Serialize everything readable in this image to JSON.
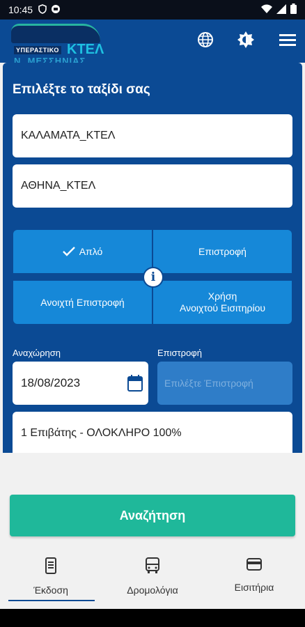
{
  "status_bar": {
    "time": "10:45"
  },
  "header": {
    "logo": {
      "tag": "ΥΠΕΡΑΣΤΙΚΟ",
      "brand": "ΚΤΕΛ",
      "region": "Ν. ΜΕΣΣΗΝΙΑΣ"
    },
    "icons": [
      "globe-icon",
      "brightness-icon",
      "menu-icon"
    ]
  },
  "trip_form": {
    "title": "Επιλέξτε το ταξίδι σας",
    "from_value": "ΚΑΛΑΜΑΤΑ_ΚΤΕΛ",
    "to_value": "ΑΘΗΝΑ_ΚΤΕΛ",
    "trip_types": {
      "one_way": "Απλό",
      "return": "Επιστροφή",
      "open_return": "Ανοιχτή Επιστροφή",
      "open_ticket_line1": "Χρήση",
      "open_ticket_line2": "Ανοιχτού Εισιτηρίου"
    },
    "selected_trip_type": "one_way",
    "departure_label": "Αναχώρηση",
    "departure_value": "18/08/2023",
    "return_label": "Επιστροφή",
    "return_placeholder": "Επιλέξτε Έπιστροφή",
    "passengers_value": "1 Επιβάτης - ΟΛΟΚΛΗΡΟ 100%"
  },
  "search_button": "Αναζήτηση",
  "bottom_nav": {
    "items": [
      {
        "label": "Έκδοση",
        "icon": "ticket-phone-icon"
      },
      {
        "label": "Δρομολόγια",
        "icon": "bus-icon"
      },
      {
        "label": "Εισιτήρια",
        "icon": "wallet-icon"
      }
    ],
    "active_index": 0
  },
  "colors": {
    "primary": "#0b4a94",
    "button_blue": "#1688d8",
    "search_green": "#1fb89a"
  }
}
